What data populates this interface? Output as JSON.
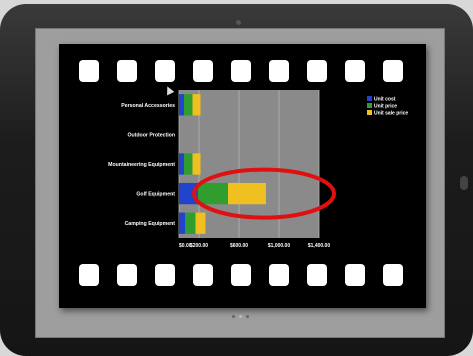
{
  "chart_data": {
    "type": "bar",
    "orientation": "horizontal",
    "stacked": true,
    "categories": [
      "Personal Accessories",
      "Outdoor Protection",
      "Mountaineering Equipment",
      "Golf Equipment",
      "Camping Equipment"
    ],
    "series": [
      {
        "name": "Unit cost",
        "values": [
          50,
          0,
          50,
          190,
          60
        ],
        "color": "#2244cc"
      },
      {
        "name": "Unit price",
        "values": [
          85,
          0,
          85,
          300,
          105
        ],
        "color": "#2f9e2f"
      },
      {
        "name": "Unit sale price",
        "values": [
          80,
          0,
          80,
          380,
          100
        ],
        "color": "#f0c020"
      }
    ],
    "x_ticks": [
      "$0.00",
      "$200.00",
      "$600.00",
      "$1,000.00",
      "$1,400.00"
    ],
    "x_tick_values": [
      0,
      200,
      600,
      1000,
      1400
    ],
    "xlim": [
      0,
      1400
    ],
    "grid": true,
    "legend_position": "top-right",
    "annotation": {
      "shape": "ellipse",
      "color": "#e01010",
      "target": "Golf Equipment"
    }
  },
  "carousel": {
    "pages": 3,
    "active_page": 1
  }
}
